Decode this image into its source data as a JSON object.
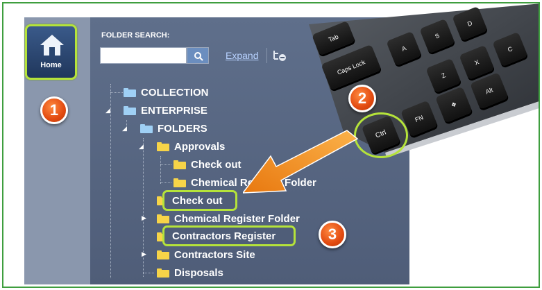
{
  "home": {
    "label": "Home",
    "icon": "house-icon"
  },
  "badges": [
    "1",
    "2",
    "3"
  ],
  "panel": {
    "title": "FOLDER SEARCH:",
    "search_placeholder": "",
    "expand_label": "Expand",
    "search_icon": "magnifier-icon",
    "tree_toggle_icon": "tree-collapse-icon"
  },
  "tree": {
    "collection": "COLLECTION",
    "enterprise": "ENTERPRISE",
    "folders": "FOLDERS",
    "approvals": "Approvals",
    "approvals_checkout": "Check out",
    "approvals_chemical": "Chemical Register Folder",
    "checkout": "Check out",
    "chemical": "Chemical Register Folder",
    "contractors_register": "Contractors Register",
    "contractors_site": "Contractors Site",
    "disposals": "Disposals"
  },
  "keyboard": {
    "keys": {
      "tab": "Tab",
      "caps": "Caps Lock",
      "a": "A",
      "s": "S",
      "d": "D",
      "z": "Z",
      "x": "X",
      "c": "C",
      "ctrl": "Ctrl",
      "fn": "FN",
      "alt": "Alt"
    }
  },
  "colors": {
    "highlight": "#b5e33a",
    "badge": "#e24a10",
    "panel": "#5a6985",
    "frame": "#3f9e3f",
    "arrow": "#f08a1c"
  }
}
